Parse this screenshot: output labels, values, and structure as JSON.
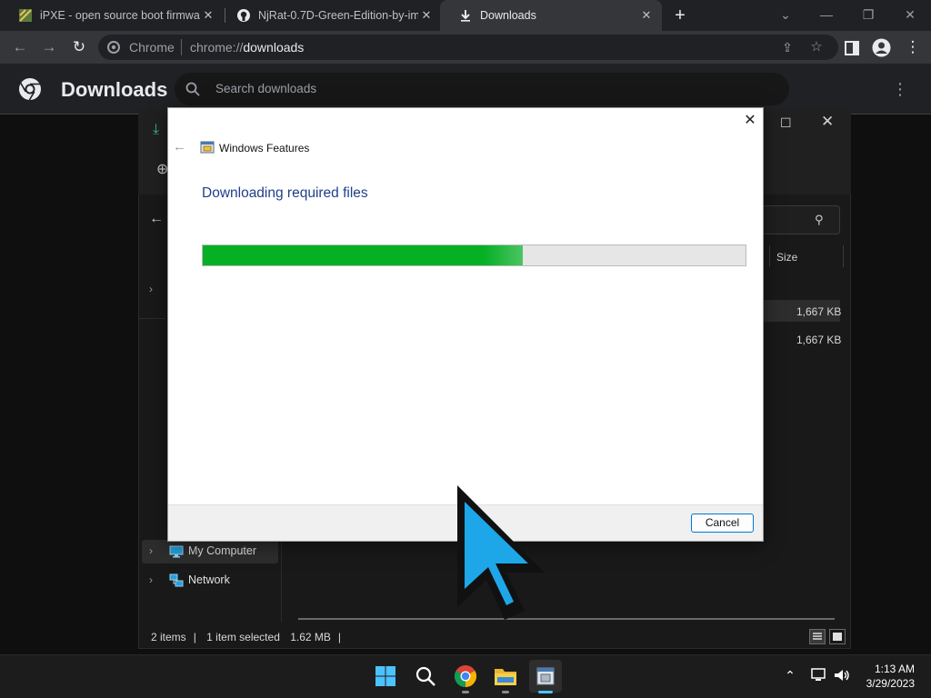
{
  "browser": {
    "tabs": [
      {
        "title": "iPXE - open source boot firmware",
        "icon": "ipxe-favicon"
      },
      {
        "title": "NjRat-0.7D-Green-Edition-by-im",
        "icon": "github-icon"
      },
      {
        "title": "Downloads",
        "icon": "download-icon"
      }
    ],
    "address_site": "Chrome",
    "address_url_prefix": "chrome://",
    "address_url_path": "downloads"
  },
  "downloads_page": {
    "title": "Downloads",
    "search_placeholder": "Search downloads"
  },
  "explorer": {
    "column_size": "Size",
    "files": [
      {
        "size": "1,667 KB",
        "selected": true
      },
      {
        "size": "1,667 KB",
        "selected": false
      }
    ],
    "nav": [
      {
        "label": "My Computer",
        "icon": "computer-icon"
      },
      {
        "label": "Network",
        "icon": "network-icon"
      }
    ],
    "status": {
      "items": "2 items",
      "selected": "1 item selected",
      "size": "1.62 MB"
    }
  },
  "dialog": {
    "app_title": "Windows Features",
    "heading": "Downloading required files",
    "progress": 0.59,
    "cancel_label": "Cancel",
    "accent": "#06b025"
  },
  "taskbar": {
    "time": "1:13 AM",
    "date": "3/29/2023"
  }
}
